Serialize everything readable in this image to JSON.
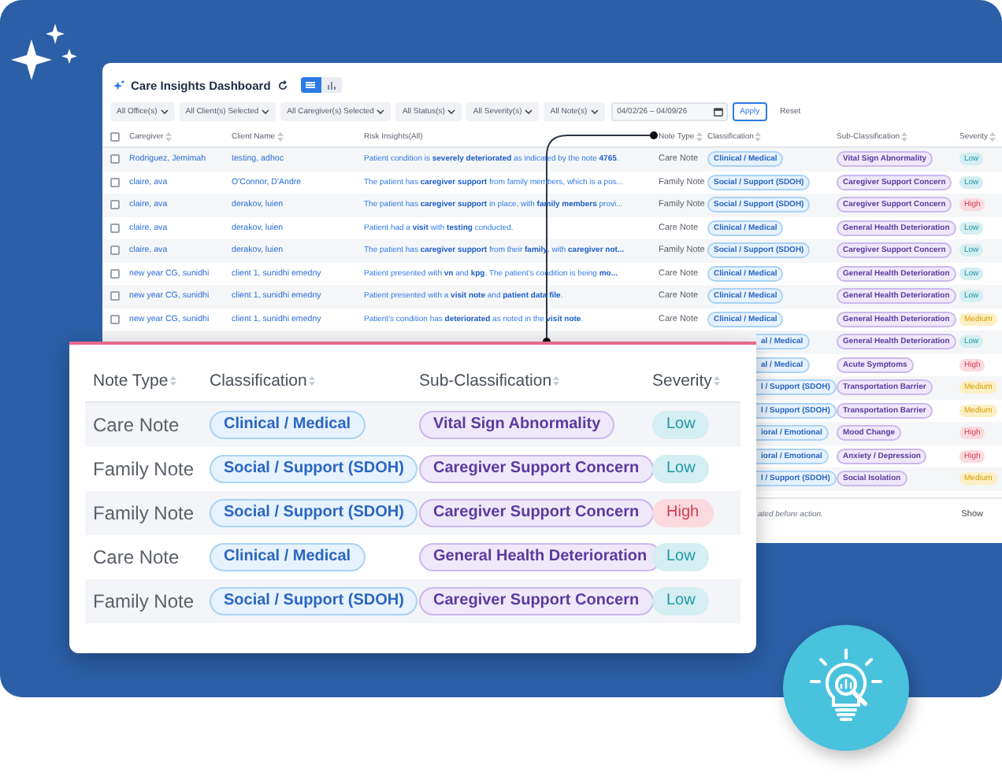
{
  "dashboard": {
    "title": "Care Insights Dashboard",
    "view_toggle": [
      {
        "kind": "list",
        "selected": true
      },
      {
        "kind": "chart",
        "selected": false
      }
    ],
    "filters": [
      "All Office(s)",
      "All Client(s) Selected",
      "All Caregiver(s) Selected",
      "All Status(s)",
      "All Severity(s)",
      "All Note(s)"
    ],
    "date_range": {
      "value": "04/02/26 – 04/09/26"
    },
    "apply_button": "Apply",
    "reset_button": "Reset",
    "table": {
      "select_all": {
        "checked": false
      },
      "columns": [
        {
          "label": "Caregiver",
          "sortable": true
        },
        {
          "label": "Client Name",
          "sortable": true
        },
        {
          "label": "Risk Insights(All)",
          "sortable": false
        },
        {
          "label": "Note Type",
          "sortable": true
        },
        {
          "label": "Classification",
          "sortable": true
        },
        {
          "label": "Sub-Classification",
          "sortable": true
        },
        {
          "label": "Severity",
          "sortable": true
        }
      ],
      "rows": [
        {
          "checked": false,
          "caregiver": "Rodriguez, Jemimah",
          "client": "testing, adhoc",
          "insight": "Patient condition is **severely deteriorated** as indicated by the note **4765**.",
          "note_type": "Care Note",
          "classification": "Clinical / Medical",
          "sub_classification": "Vital Sign Abnormality",
          "severity": "Low",
          "color": "#d4eef1"
        },
        {
          "checked": false,
          "caregiver": "claire, ava",
          "client": "O'Connor, D'Andre",
          "insight": "The patient has **caregiver support** from family members, which is a pos...",
          "note_type": "Family Note",
          "classification": "Social / Support (SDOH)",
          "sub_classification": "Caregiver Support Concern",
          "severity": "Low",
          "color": "#d4eef1"
        },
        {
          "checked": false,
          "caregiver": "claire, ava",
          "client": "derakov, luien",
          "insight": "The patient has **caregiver support** in place, with **family members** provi...",
          "note_type": "Family Note",
          "classification": "Social / Support (SDOH)",
          "sub_classification": "Caregiver Support Concern",
          "severity": "High",
          "color": "#fbdadf"
        },
        {
          "checked": false,
          "caregiver": "claire, ava",
          "client": "derakov, luien",
          "insight": "Patient had a **visit** with **testing** conducted.",
          "note_type": "Care Note",
          "classification": "Clinical / Medical",
          "sub_classification": "General Health Deterioration",
          "severity": "Low",
          "color": "#d4eef1"
        },
        {
          "checked": false,
          "caregiver": "claire, ava",
          "client": "derakov, luien",
          "insight": "The patient has **caregiver support** from their **family**, with **caregiver not...**",
          "note_type": "Family Note",
          "classification": "Social / Support (SDOH)",
          "sub_classification": "Caregiver Support Concern",
          "severity": "Low",
          "color": "#d4eef1"
        },
        {
          "checked": false,
          "caregiver": "new year CG, sunidhi",
          "client": "client 1, sunidhi emedny",
          "insight": "Patient presented with **vn** and **kpg**. The patient's condition is being **mo...**",
          "note_type": "Care Note",
          "classification": "Clinical / Medical",
          "sub_classification": "General Health Deterioration",
          "severity": "Low",
          "color": "#d4eef1"
        },
        {
          "checked": false,
          "caregiver": "new year CG, sunidhi",
          "client": "client 1, sunidhi emedny",
          "insight": "Patient presented with a **visit note** and **patient data file**.",
          "note_type": "Care Note",
          "classification": "Clinical / Medical",
          "sub_classification": "General Health Deterioration",
          "severity": "Low",
          "color": "#d4eef1"
        },
        {
          "checked": false,
          "caregiver": "new year CG, sunidhi",
          "client": "client 1, sunidhi emedny",
          "insight": "Patient's condition has **deteriorated** as noted in the **visit note**.",
          "note_type": "Care Note",
          "classification": "Clinical / Medical",
          "sub_classification": "General Health Deterioration",
          "severity": "Medium",
          "color": "#fcefc4"
        }
      ],
      "partial_rows": [
        {
          "classification": "al / Medical",
          "sub_classification": "General Health Deterioration",
          "severity": "Low",
          "color": "#d4eef1"
        },
        {
          "classification": "al / Medical",
          "sub_classification": "Acute Symptoms",
          "severity": "High",
          "color": "#fbdadf"
        },
        {
          "classification": "l / Support (SDOH)",
          "sub_classification": "Transportation Barrier",
          "severity": "Medium",
          "color": "#fcefc4"
        },
        {
          "classification": "l / Support (SDOH)",
          "sub_classification": "Transportation Barrier",
          "severity": "Medium",
          "color": "#fcefc4"
        },
        {
          "classification": "ioral / Emotional",
          "sub_classification": "Mood Change",
          "severity": "High",
          "color": "#fbdadf"
        },
        {
          "classification": "ioral / Emotional",
          "sub_classification": "Anxiety / Depression",
          "severity": "High",
          "color": "#fbdadf"
        },
        {
          "classification": "l / Support (SDOH)",
          "sub_classification": "Social Isolation",
          "severity": "Medium",
          "color": "#fcefc4"
        }
      ]
    },
    "footer": {
      "text": "ated before action.",
      "action": "Show"
    }
  },
  "callout": {
    "columns": [
      "Note Type",
      "Classification",
      "Sub-Classification",
      "Severity"
    ],
    "rows": [
      {
        "note_type": "Care Note",
        "classification": "Clinical / Medical",
        "sub_classification": "Vital Sign Abnormality",
        "severity": "Low",
        "color": "#d4eef1"
      },
      {
        "note_type": "Family Note",
        "classification": "Social / Support (SDOH)",
        "sub_classification": "Caregiver Support Concern",
        "severity": "Low",
        "color": "#d4eef1"
      },
      {
        "note_type": "Family Note",
        "classification": "Social / Support (SDOH)",
        "sub_classification": "Caregiver Support Concern",
        "severity": "High",
        "color": "#fbdadf"
      },
      {
        "note_type": "Care Note",
        "classification": "Clinical / Medical",
        "sub_classification": "General Health Deterioration",
        "severity": "Low",
        "color": "#d4eef1"
      },
      {
        "note_type": "Family Note",
        "classification": "Social / Support (SDOH)",
        "sub_classification": "Caregiver Support Concern",
        "severity": "Low",
        "color": "#d4eef1"
      }
    ]
  }
}
